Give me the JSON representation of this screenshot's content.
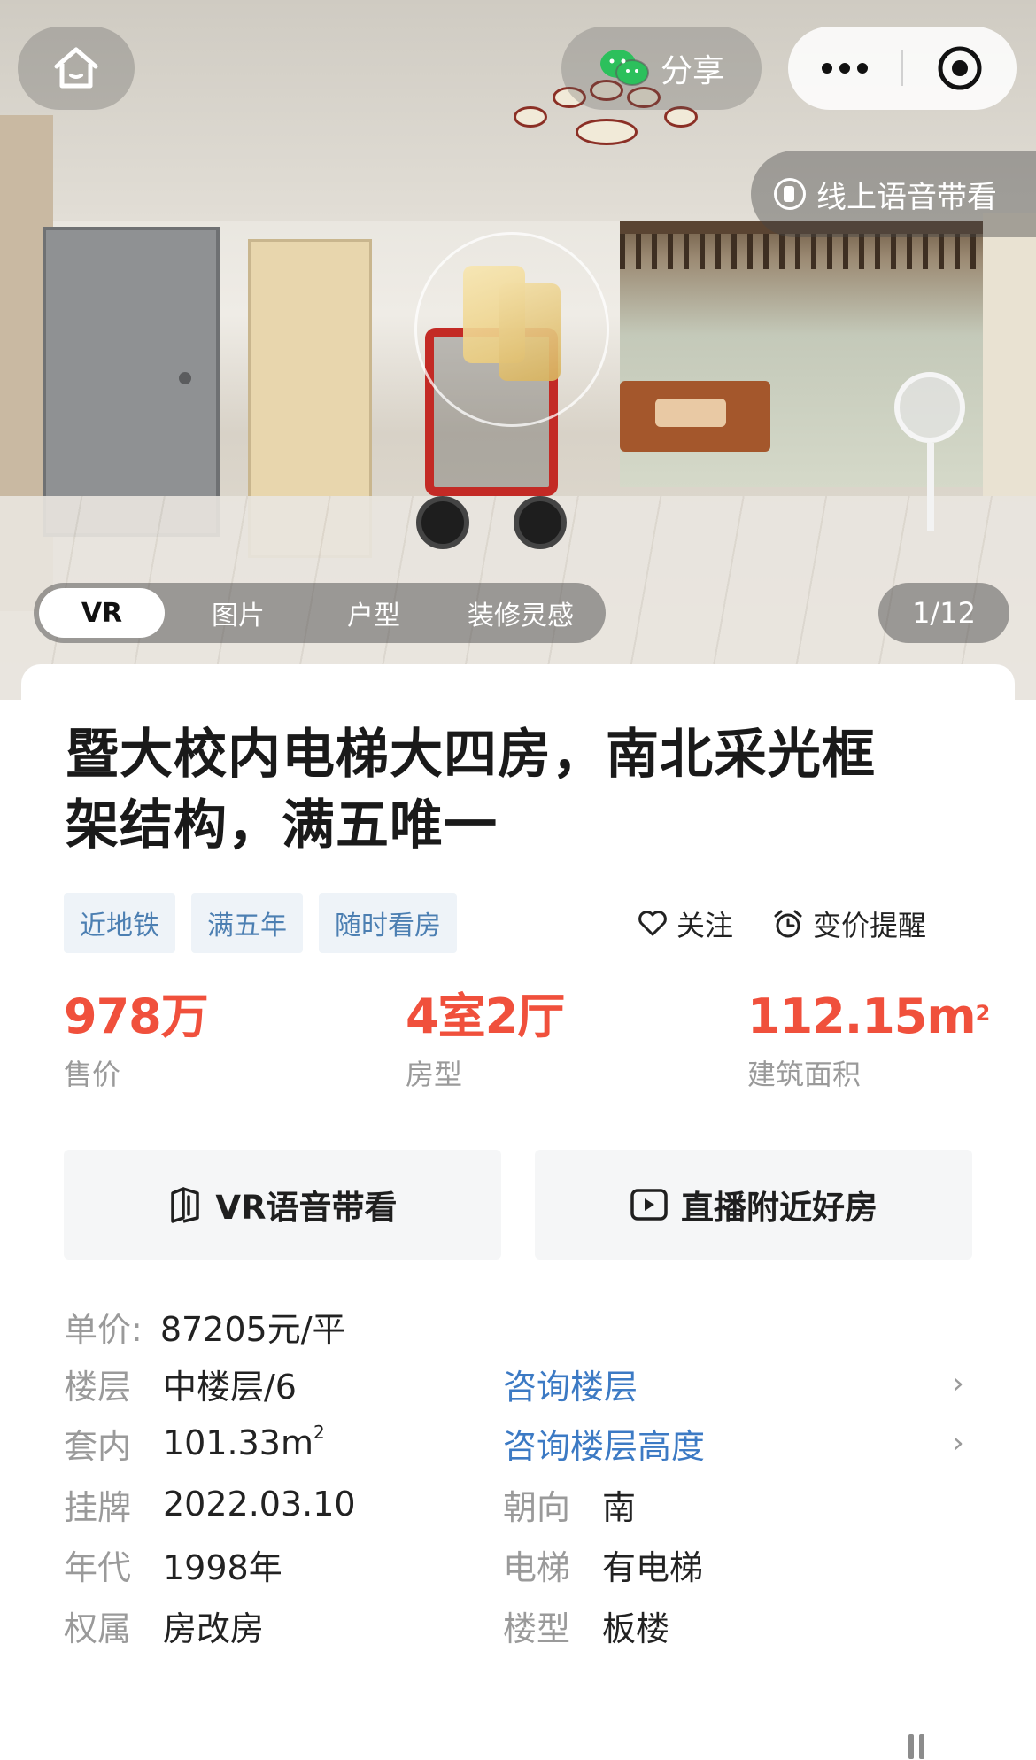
{
  "header": {
    "share_label": "分享",
    "voice_tour_label": "线上语音带看",
    "media_tabs": [
      "VR",
      "图片",
      "户型",
      "装修灵感"
    ],
    "counter": "1/12"
  },
  "listing": {
    "title_line1": "暨大校内电梯大四房，南北采光框",
    "title_line2": "架结构，满五唯一",
    "tags": [
      "近地铁",
      "满五年",
      "随时看房"
    ],
    "follow_label": "关注",
    "price_alert_label": "变价提醒",
    "stats": [
      {
        "value": "978万",
        "label": "售价"
      },
      {
        "value": "4室2厅",
        "label": "房型"
      },
      {
        "value": "112.15m",
        "sup": "2",
        "label": "建筑面积"
      }
    ],
    "actions": {
      "vr_voice": "VR语音带看",
      "live_nearby": "直播附近好房"
    },
    "unit_price": {
      "key": "单价:",
      "value": "87205元/平"
    },
    "details": {
      "floor": {
        "key": "楼层",
        "value": "中楼层/6",
        "link": "咨询楼层"
      },
      "inner": {
        "key": "套内",
        "value": "101.33m",
        "sup": "2",
        "link": "咨询楼层高度"
      },
      "listed": {
        "key": "挂牌",
        "value": "2022.03.10",
        "key2": "朝向",
        "value2": "南"
      },
      "year": {
        "key": "年代",
        "value": "1998年",
        "key2": "电梯",
        "value2": "有电梯"
      },
      "ownership": {
        "key": "权属",
        "value": "房改房",
        "key2": "楼型",
        "value2": "板楼"
      }
    }
  },
  "colors": {
    "accent_red": "#f0503c",
    "link_blue": "#3c7ac4",
    "tag_bg": "#eef3f8",
    "tag_text": "#4c7fb2",
    "wechat_green": "#2cc05c"
  },
  "icons": [
    "home-icon",
    "wechat-icon",
    "more-icon",
    "target-icon",
    "voice-tour-icon",
    "heart-icon",
    "alarm-clock-icon",
    "vr-cube-icon",
    "play-icon",
    "chevron-right-icon"
  ]
}
